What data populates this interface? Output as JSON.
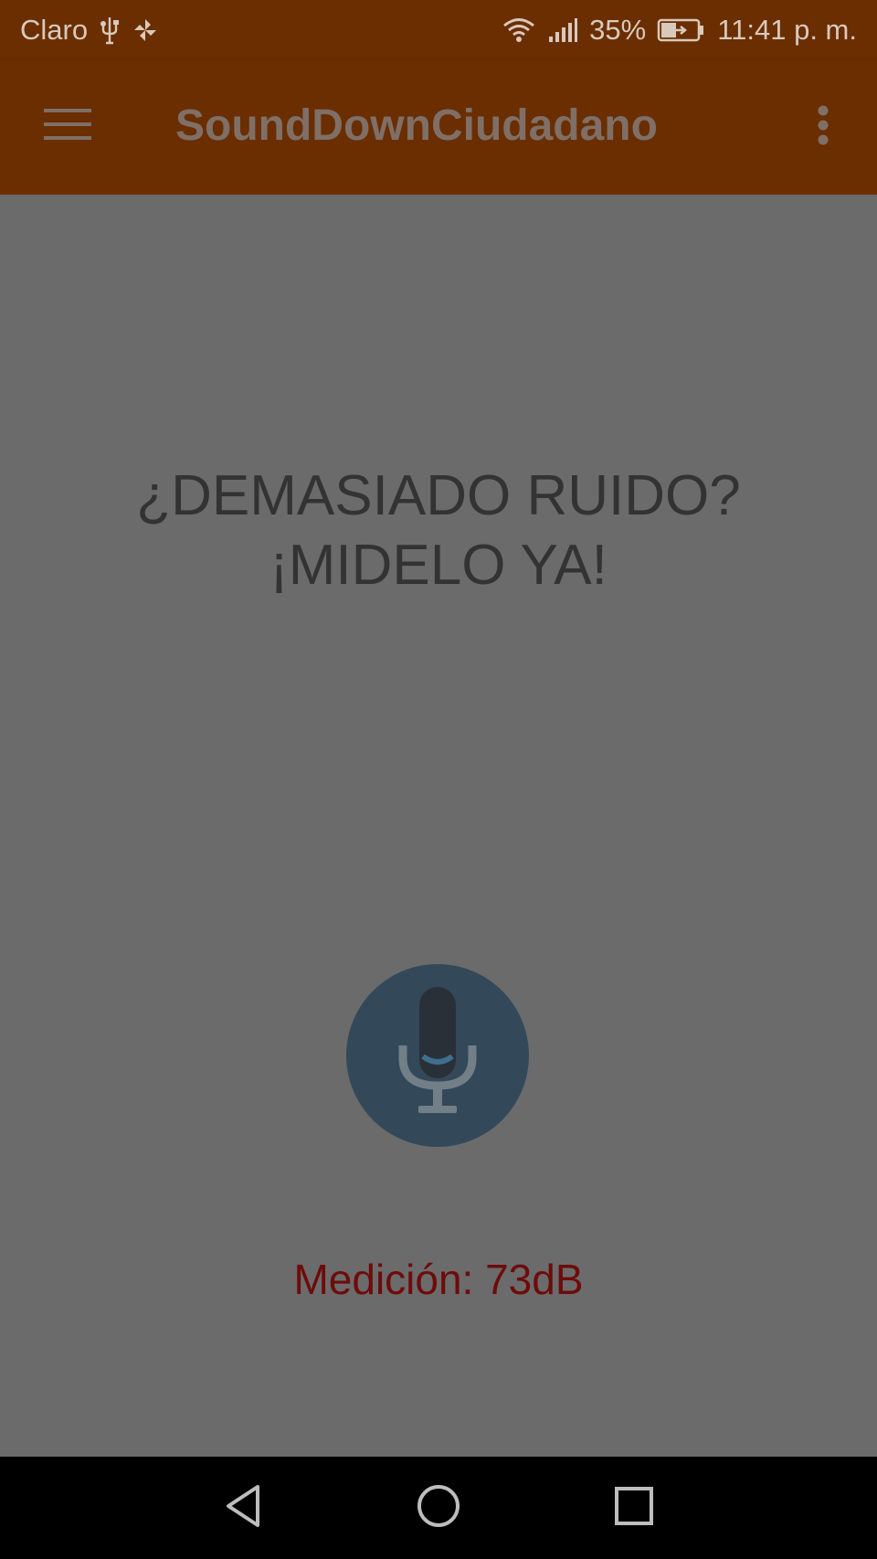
{
  "status_bar": {
    "carrier": "Claro",
    "battery": "35%",
    "time": "11:41 p. m.",
    "icons": [
      "usb-icon",
      "pinwheel-icon",
      "wifi-icon",
      "signal-icon",
      "battery-charging-icon"
    ]
  },
  "app_bar": {
    "title": "SoundDownCiudadano",
    "menu_icon": "hamburger-menu-icon",
    "overflow_icon": "more-vert-icon"
  },
  "main": {
    "headline_line1": "¿DEMASIADO RUIDO?",
    "headline_line2": "¡MIDELO YA!",
    "mic_icon": "microphone-icon",
    "measurement": "Medición: 73dB"
  },
  "nav_bar": {
    "icons": [
      "back-icon",
      "home-icon",
      "recents-icon"
    ]
  },
  "colors": {
    "app_bar": "#6a2e00",
    "content_background": "#6b6b6b",
    "mic_button": "#33495a",
    "measurement_text": "#6e0b0b"
  }
}
